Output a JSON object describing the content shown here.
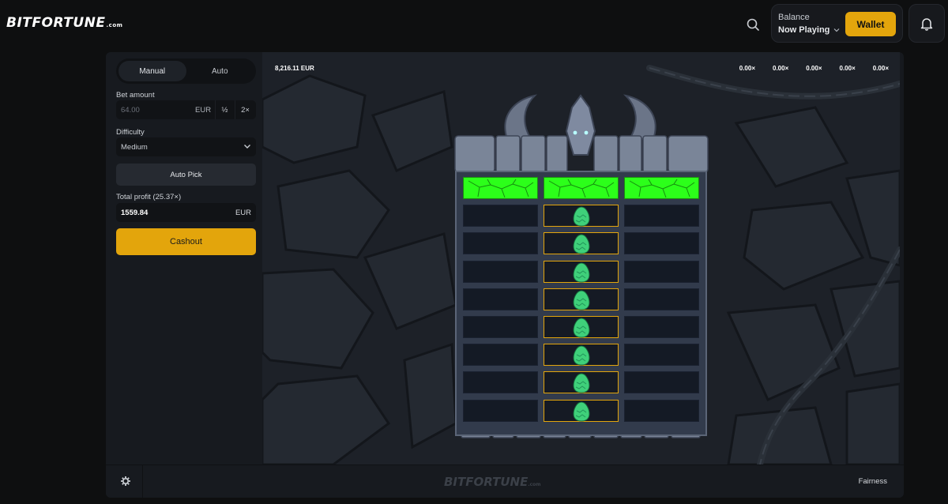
{
  "header": {
    "logo": "BITFORTUNE",
    "logo_suffix": ".com",
    "balance_label": "Balance",
    "balance_value": "Now Playing",
    "wallet_label": "Wallet"
  },
  "sidebar": {
    "tabs": [
      {
        "label": "Manual",
        "active": true
      },
      {
        "label": "Auto",
        "active": false
      }
    ],
    "bet_amount_label": "Bet amount",
    "bet_amount_value": "64.00",
    "bet_currency": "EUR",
    "half_label": "½",
    "double_label": "2×",
    "difficulty_label": "Difficulty",
    "difficulty_value": "Medium",
    "autopick_label": "Auto Pick",
    "total_profit_label": "Total profit (25.37×)",
    "total_profit_value": "1559.84",
    "total_profit_currency": "EUR",
    "cashout_label": "Cashout"
  },
  "game": {
    "balance": "8,216.11 EUR",
    "multipliers": [
      "0.00×",
      "0.00×",
      "0.00×",
      "0.00×",
      "0.00×"
    ],
    "columns": 3,
    "rows": 9,
    "picked_column": 1,
    "top_row_state": "revealed-green",
    "colors": {
      "accent": "#e3a50c",
      "revealed": "#2cff1a",
      "egg": "#3fd07a"
    }
  },
  "footer": {
    "logo": "BITFORTUNE",
    "logo_suffix": ".com",
    "fairness_label": "Fairness"
  },
  "icons": {
    "search": "search-icon",
    "chevron": "chevron-down-icon",
    "bell": "bell-icon",
    "gear": "gear-icon",
    "egg": "dragon-egg-icon",
    "dragon": "dragon-icon"
  }
}
